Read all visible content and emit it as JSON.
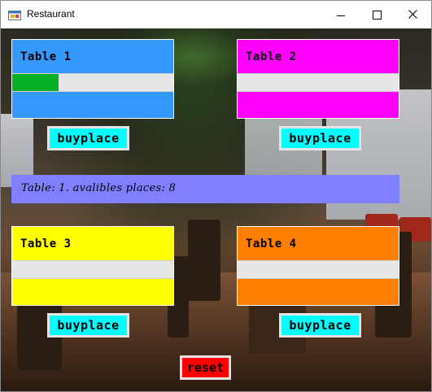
{
  "window": {
    "title": "Restaurant",
    "app_icon": "window-app-icon",
    "controls": {
      "minimize": "minimize-icon",
      "maximize": "maximize-icon",
      "close": "close-icon"
    }
  },
  "tables": [
    {
      "label": "Table 1",
      "color": "#3399ff",
      "progress": 0.29,
      "button": "buyplace"
    },
    {
      "label": "Table 2",
      "color": "#ff00ff",
      "progress": 0,
      "button": "buyplace"
    },
    {
      "label": "Table 3",
      "color": "#ffff00",
      "progress": 0,
      "button": "buyplace"
    },
    {
      "label": "Table 4",
      "color": "#ff8000",
      "progress": 0,
      "button": "buyplace"
    }
  ],
  "info": {
    "text": "Table: 1. avalibles places: 8",
    "color": "#8080ff"
  },
  "reset": {
    "label": "reset",
    "color": "#ff0000"
  },
  "colors": {
    "button": "#00ffff",
    "progress_fill": "#06b025"
  }
}
